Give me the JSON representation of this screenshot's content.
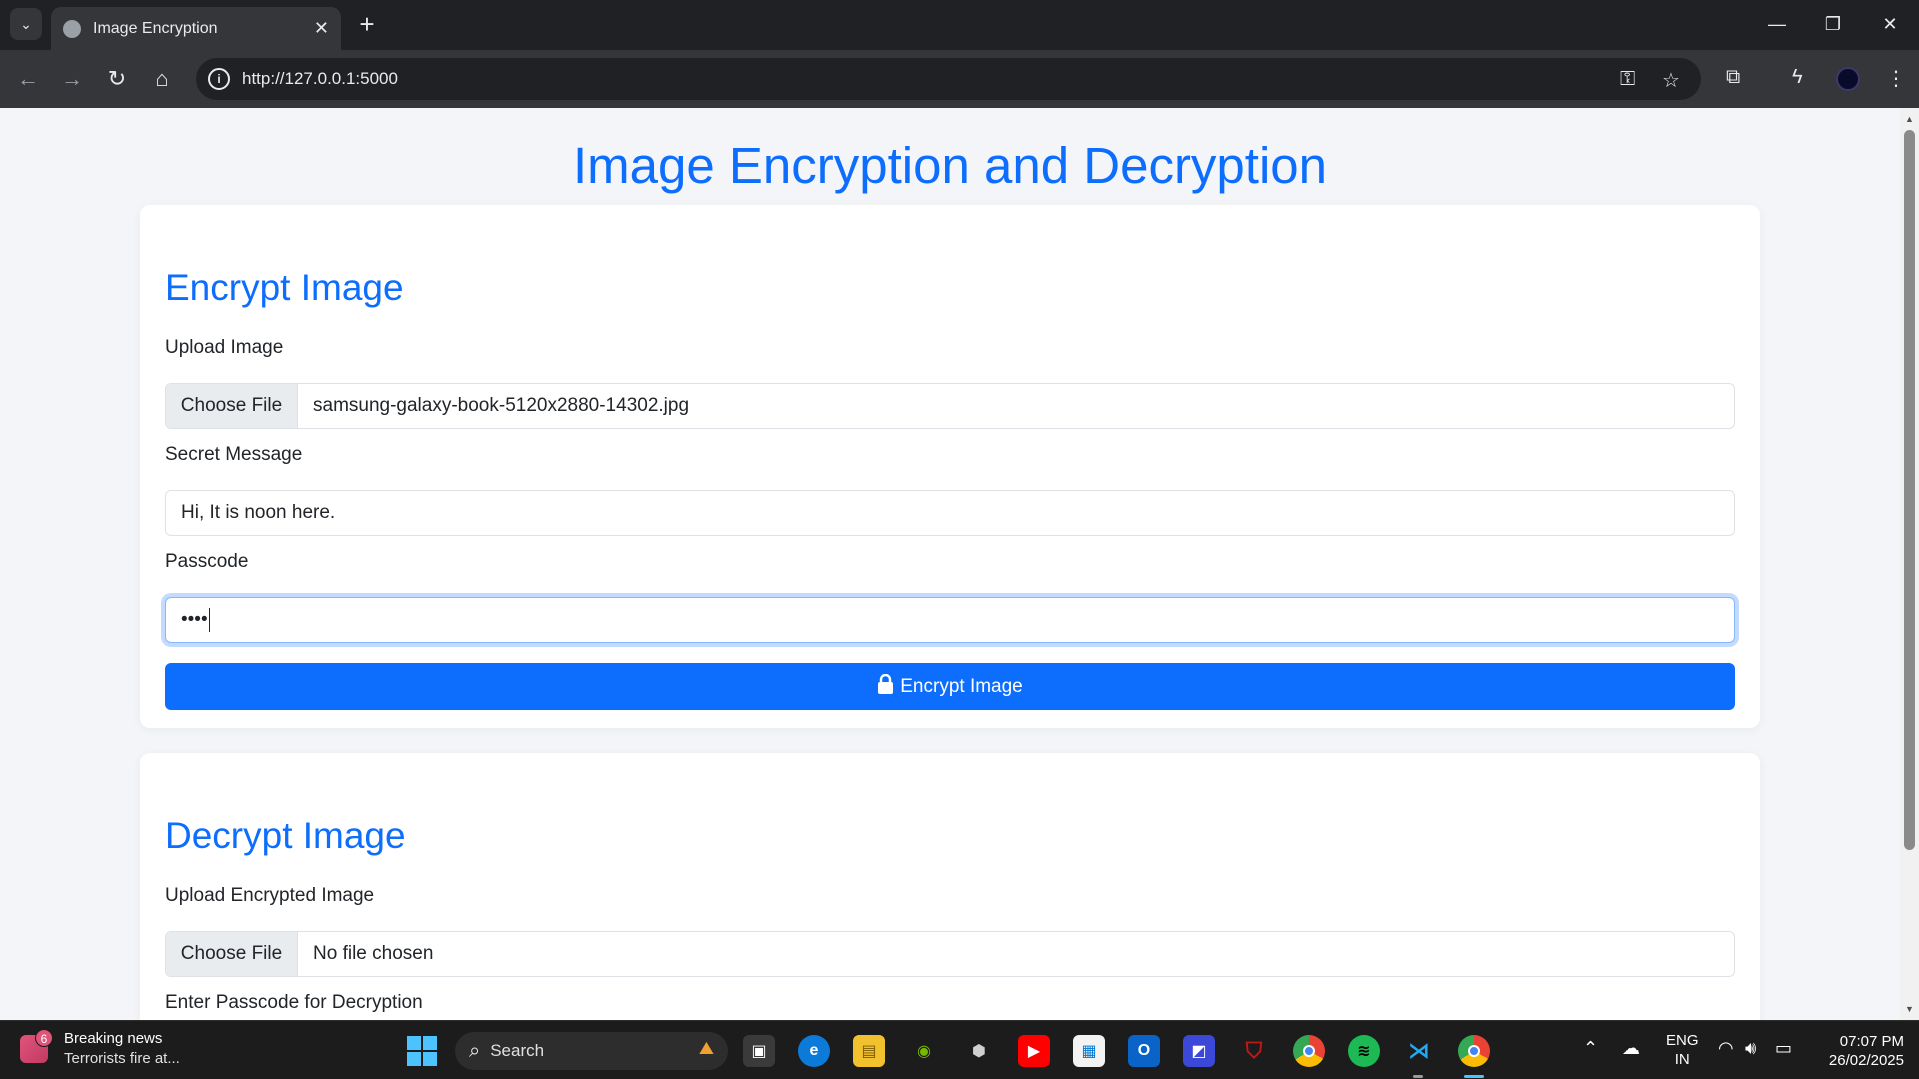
{
  "browser": {
    "tab_title": "Image Encryption",
    "url": "http://127.0.0.1:5000",
    "icons": [
      "tab-search-icon",
      "globe-icon",
      "close-icon",
      "plus-icon",
      "minimize-icon",
      "restore-icon",
      "window-close-icon",
      "back-icon",
      "forward-icon",
      "reload-icon",
      "home-icon",
      "info-icon",
      "key-icon",
      "star-icon",
      "extensions-icon",
      "performance-icon",
      "profile-avatar"
    ]
  },
  "page": {
    "title": "Image Encryption and Decryption",
    "encrypt": {
      "heading": "Encrypt Image",
      "upload_label": "Upload Image",
      "choose_file_label": "Choose File",
      "file_name": "samsung-galaxy-book-5120x2880-14302.jpg",
      "message_label": "Secret Message",
      "message_value": "Hi, It is noon here.",
      "passcode_label": "Passcode",
      "passcode_value": "••••",
      "button_label": "Encrypt Image"
    },
    "decrypt": {
      "heading": "Decrypt Image",
      "upload_label": "Upload Encrypted Image",
      "choose_file_label": "Choose File",
      "file_name": "No file chosen",
      "passcode_label": "Enter Passcode for Decryption"
    }
  },
  "taskbar": {
    "news_badge": "6",
    "news_title": "Breaking news",
    "news_subtitle": "Terrorists fire at...",
    "search_label": "Search",
    "language_line1": "ENG",
    "language_line2": "IN",
    "time": "07:07 PM",
    "date": "26/02/2025",
    "apps": [
      "start-icon",
      "task-view-icon",
      "edge-icon",
      "file-explorer-icon",
      "nvidia-icon",
      "unity-icon",
      "youtube-icon",
      "microsoft-store-icon",
      "outlook-icon",
      "visual-studio-icon",
      "mcafee-icon",
      "chrome-icon",
      "spotify-icon",
      "vscode-icon",
      "chrome-profile-icon"
    ]
  },
  "colors": {
    "accent": "#0d6efd",
    "page_bg": "#f4f5f8",
    "chrome_bg": "#202124",
    "taskbar_bg": "#1c1c1c"
  }
}
